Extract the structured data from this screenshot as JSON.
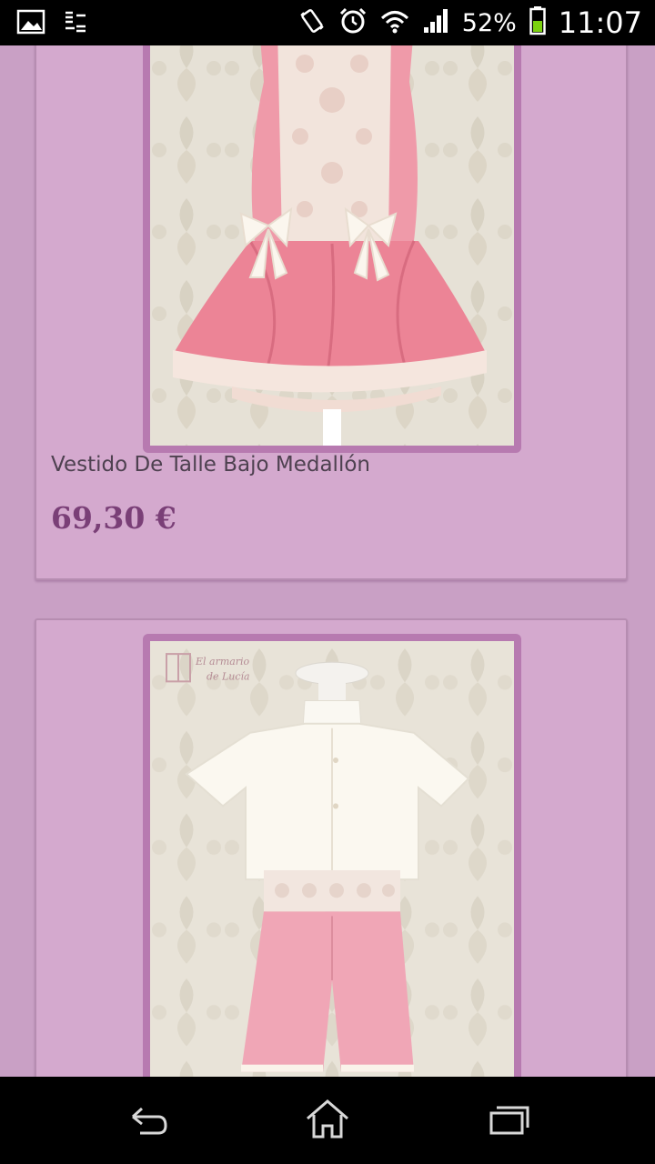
{
  "status_bar": {
    "battery": "52%",
    "time": "11:07",
    "icons": [
      "gallery-icon",
      "usb-sync-icon",
      "vibrate-icon",
      "alarm-icon",
      "wifi-icon",
      "signal-icon",
      "battery-icon"
    ]
  },
  "products": [
    {
      "name": "Vestido De Talle Bajo Medallón",
      "price": "69,30 €",
      "image": "pink-dress-with-lace-photo"
    },
    {
      "name": "",
      "price": "",
      "image": "white-shirt-pink-shorts-photo",
      "watermark": "El armario de Lucía"
    }
  ],
  "nav_bar": {
    "buttons": [
      "back-icon",
      "home-icon",
      "recents-icon"
    ]
  },
  "colors": {
    "background": "#c9a0c5",
    "card": "#d4a9ce",
    "price": "#7a3f77",
    "image_frame": "#b77ab0"
  }
}
